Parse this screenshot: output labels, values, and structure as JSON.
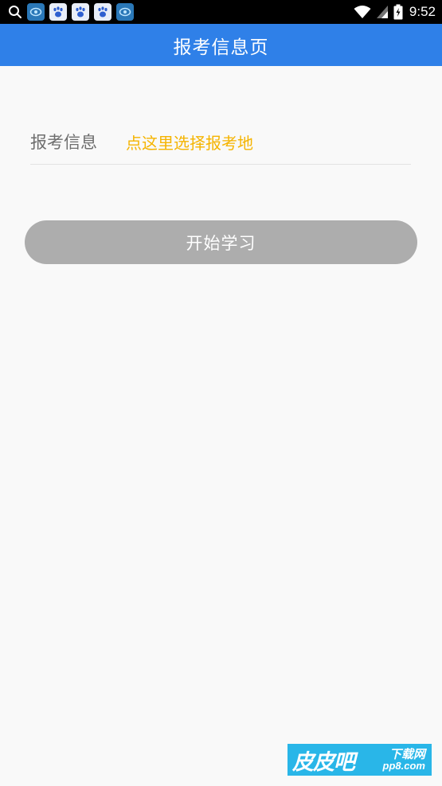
{
  "status_bar": {
    "time": "9:52",
    "icons": [
      "search-icon",
      "browser-icon",
      "baidu-paw-icon",
      "baidu-paw-icon",
      "baidu-paw-icon",
      "browser-icon",
      "wifi-icon",
      "signal-icon",
      "battery-charging-icon"
    ]
  },
  "app_bar": {
    "title": "报考信息页"
  },
  "info": {
    "label": "报考信息",
    "select_prompt": "点这里选择报考地"
  },
  "start_button": {
    "label": "开始学习"
  },
  "watermark": {
    "main": "皮皮吧",
    "sub": "下载网",
    "domain": "pp8.com"
  },
  "colors": {
    "app_bar": "#2f80e8",
    "select_prompt": "#f5b400",
    "button": "#adadad",
    "watermark": "#29b6e8"
  }
}
